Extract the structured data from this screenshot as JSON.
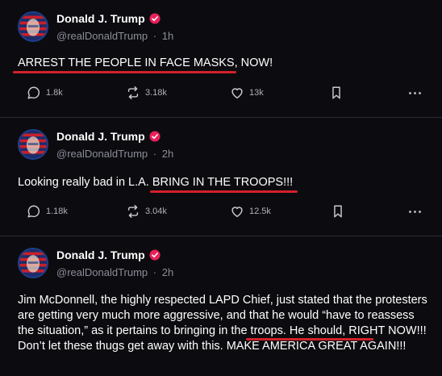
{
  "posts": [
    {
      "author": "Donald J. Trump",
      "handle": "@realDonaldTrump",
      "sep": "·",
      "time": "1h",
      "text": "ARREST THE PEOPLE IN FACE MASKS, NOW!",
      "replies": "1.8k",
      "reposts": "3.18k",
      "likes": "13k"
    },
    {
      "author": "Donald J. Trump",
      "handle": "@realDonaldTrump",
      "sep": "·",
      "time": "2h",
      "text_pre": "Looking really bad in L.A. ",
      "text_mark": "BRING IN THE TROOPS!!!",
      "replies": "1.18k",
      "reposts": "3.04k",
      "likes": "12.5k"
    },
    {
      "author": "Donald J. Trump",
      "handle": "@realDonaldTrump",
      "sep": "·",
      "time": "2h",
      "text_1": "Jim McDonnell, the highly respected LAPD Chief, just stated that the protesters are getting very much more aggressive, and that he would “have to reassess the situation,” as it pertains to ",
      "text_mark": "bringing in the troops.",
      "text_2": " He should, RIGHT NOW!!! Don’t let these thugs get away with this. MAKE AMERICA GREAT AGAIN!!!"
    }
  ],
  "icons": {
    "reply": "speech-bubble-icon",
    "repost": "repost-arrows-icon",
    "like": "heart-icon",
    "bookmark": "bookmark-icon",
    "more": "more-dots-icon",
    "verified": "verified-badge-icon"
  },
  "colors": {
    "background": "#0c0c10",
    "verified": "#e8205a",
    "underline": "#d4202a",
    "muted": "#8b8d98"
  }
}
